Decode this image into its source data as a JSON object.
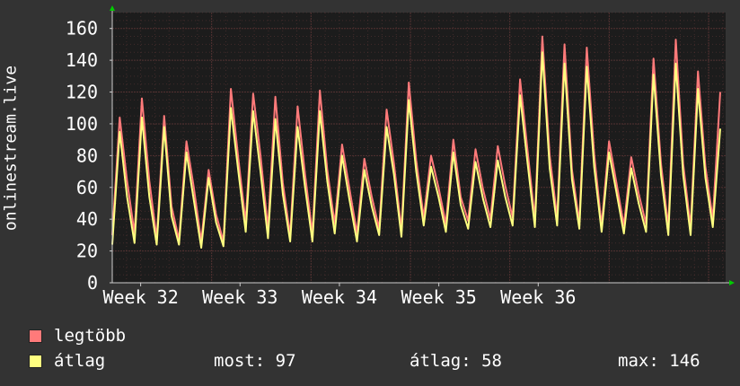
{
  "window": {
    "vertical_label": "onlinestream.live"
  },
  "colors": {
    "background": "#333333",
    "plot_bg": "#1c1c1c",
    "grid": "#5a3535",
    "max_color": "#ff7a7a",
    "avg_color": "#ffff80",
    "text": "#ffffff",
    "arrow": "#00cc00"
  },
  "legend": {
    "max_label": "legtöbb",
    "avg_label": "átlag",
    "now_text": "most: 97",
    "avg_text": "átlag: 58",
    "max_text": "max: 146"
  },
  "chart_data": {
    "type": "area",
    "title": "",
    "xlabel": "",
    "ylabel": "onlinestream.live",
    "ylim": [
      0,
      170
    ],
    "yticks": [
      0,
      20,
      40,
      60,
      80,
      100,
      120,
      140,
      160
    ],
    "xticks": [
      "Week 32",
      "Week 33",
      "Week 34",
      "Week 35",
      "Week 36"
    ],
    "x_domain": [
      0,
      43.2
    ],
    "grid": true,
    "legend_position": "bottom-left",
    "series": [
      {
        "name": "legtöbb",
        "values": [
          30,
          104,
          64,
          31,
          116,
          64,
          28,
          105,
          48,
          27,
          89,
          60,
          26,
          71,
          43,
          26,
          122,
          78,
          38,
          119,
          80,
          34,
          117,
          63,
          30,
          111,
          68,
          31,
          121,
          71,
          37,
          87,
          59,
          31,
          78,
          54,
          34,
          109,
          75,
          33,
          126,
          77,
          41,
          80,
          60,
          37,
          90,
          54,
          39,
          84,
          59,
          40,
          86,
          61,
          41,
          128,
          84,
          40,
          155,
          80,
          41,
          150,
          71,
          38,
          148,
          81,
          36,
          89,
          63,
          36,
          79,
          56,
          37,
          141,
          75,
          35,
          153,
          75,
          35,
          133,
          73,
          40,
          120
        ]
      },
      {
        "name": "átlag",
        "values": [
          24,
          95,
          54,
          25,
          104,
          54,
          24,
          98,
          42,
          24,
          82,
          52,
          22,
          66,
          38,
          23,
          110,
          70,
          32,
          108,
          70,
          28,
          103,
          56,
          26,
          98,
          60,
          26,
          108,
          64,
          31,
          80,
          52,
          26,
          71,
          48,
          30,
          98,
          68,
          29,
          115,
          70,
          36,
          73,
          54,
          32,
          82,
          49,
          34,
          76,
          53,
          35,
          77,
          54,
          36,
          118,
          76,
          35,
          145,
          72,
          36,
          138,
          65,
          34,
          136,
          73,
          32,
          82,
          57,
          31,
          72,
          50,
          32,
          131,
          68,
          30,
          138,
          68,
          30,
          122,
          66,
          35,
          97
        ]
      }
    ]
  }
}
